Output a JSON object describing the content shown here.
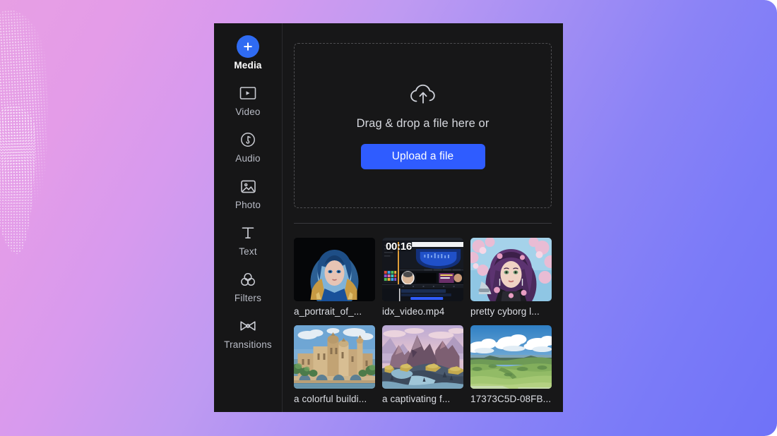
{
  "app": {
    "accent_blue": "#2f5cff",
    "panel_bg": "#171718",
    "sidebar_bg": "#161617"
  },
  "background": {
    "gradient_from": "#e79fe4",
    "gradient_to": "#6f72f8"
  },
  "sidebar": {
    "items": [
      {
        "label": "Media",
        "icon": "plus-circle-icon",
        "active": true
      },
      {
        "label": "Video",
        "icon": "video-icon",
        "active": false
      },
      {
        "label": "Audio",
        "icon": "audio-note-icon",
        "active": false
      },
      {
        "label": "Photo",
        "icon": "photo-icon",
        "active": false
      },
      {
        "label": "Text",
        "icon": "text-t-icon",
        "active": false
      },
      {
        "label": "Filters",
        "icon": "filters-icon",
        "active": false
      },
      {
        "label": "Transitions",
        "icon": "transitions-icon",
        "active": false
      }
    ]
  },
  "dropzone": {
    "icon": "cloud-upload-icon",
    "text": "Drag & drop a file here or",
    "button_label": "Upload a file"
  },
  "media": {
    "items": [
      {
        "name": "a_portrait_of_...",
        "thumb": "blue-haired-portrait",
        "badge": ""
      },
      {
        "name": "idx_video.mp4",
        "thumb": "video-editor-screen",
        "badge": "00:16"
      },
      {
        "name": "pretty cyborg l...",
        "thumb": "purple-haired-portrait",
        "badge": ""
      },
      {
        "name": "a colorful buildi...",
        "thumb": "sandstone-city",
        "badge": ""
      },
      {
        "name": "a captivating f...",
        "thumb": "fantasy-mountains",
        "badge": ""
      },
      {
        "name": "17373C5D-08FB...",
        "thumb": "green-meadow",
        "badge": ""
      }
    ]
  }
}
